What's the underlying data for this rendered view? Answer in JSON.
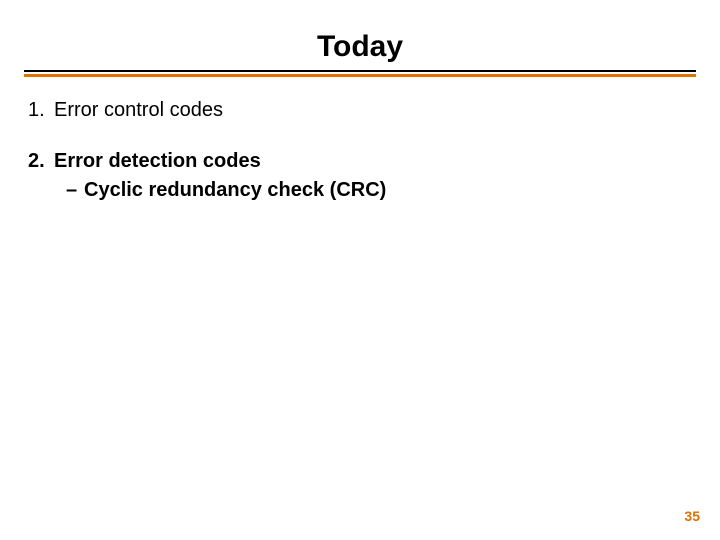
{
  "title": "Today",
  "items": [
    {
      "num": "1.",
      "label": "Error control codes",
      "bold": false,
      "sub": []
    },
    {
      "num": "2.",
      "label": "Error detection codes",
      "bold": true,
      "sub": [
        {
          "dash": "–",
          "label": "Cyclic redundancy check (CRC)"
        }
      ]
    }
  ],
  "page_number": "35"
}
